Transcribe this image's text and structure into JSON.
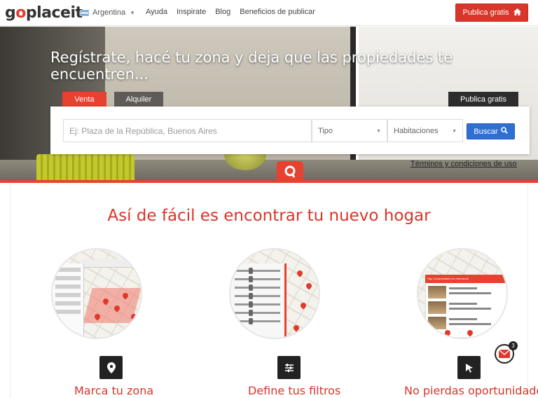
{
  "header": {
    "logo": "goplaceit",
    "country": "Argentina",
    "nav": [
      "Ayuda",
      "Inspirate",
      "Blog",
      "Beneficios de publicar"
    ],
    "publish_button": "Publica gratis"
  },
  "hero": {
    "title": "Regístrate, hacé tu zona y deja que las propiedades te encuentren...",
    "tabs": {
      "venta": "Venta",
      "alquiler": "Alquiler",
      "publica": "Publica gratis"
    },
    "search": {
      "placeholder": "Ej: Plaza de la República, Buenos Aires",
      "tipo": "Tipo",
      "habitaciones": "Habitaciones",
      "buscar": "Buscar"
    },
    "terms": "Términos y condiciones de uso"
  },
  "how_it_works": {
    "title": "Así de fácil es encontrar tu nuevo hogar",
    "features": [
      {
        "label": "Marca tu zona",
        "icon": "map-pin-icon"
      },
      {
        "label": "Define tus filtros",
        "icon": "sliders-icon"
      },
      {
        "label": "No pierdas oportunidades",
        "icon": "cursor-icon"
      }
    ],
    "list_header": "Hay 3 propiedades en este punto",
    "mail_count": "3"
  },
  "colors": {
    "accent": "#d9352a",
    "tab_active": "#e8412f",
    "search_button": "#2f6fd4"
  }
}
